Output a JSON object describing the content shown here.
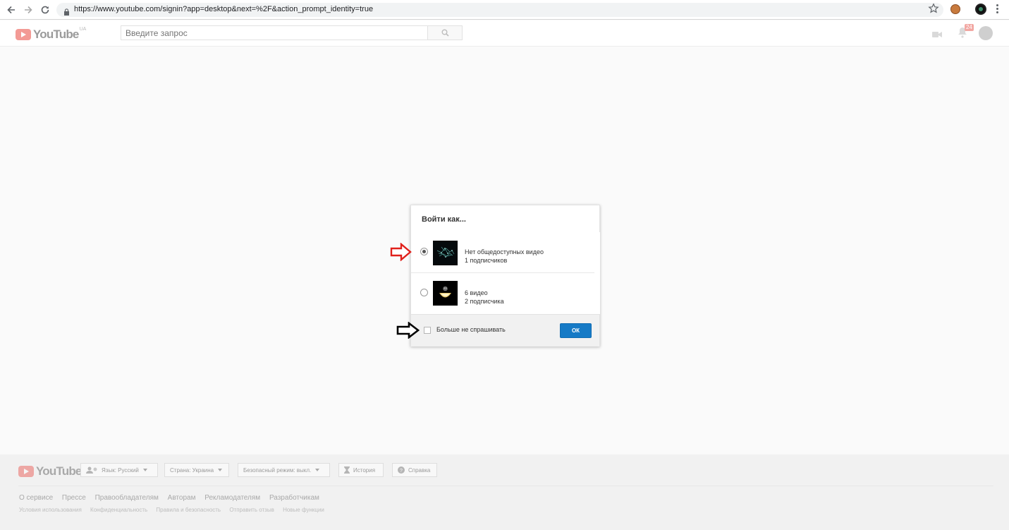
{
  "browser": {
    "url": "https://www.youtube.com/signin?app=desktop&next=%2F&action_prompt_identity=true"
  },
  "masthead": {
    "logo_text": "YouTube",
    "logo_region": "UA",
    "search_placeholder": "Введите запрос",
    "notification_count": "24"
  },
  "dialog": {
    "title": "Войти как...",
    "accounts": [
      {
        "line1": "Нет общедоступных видео",
        "line2": "1   подписчиков",
        "selected": true
      },
      {
        "line1": "6 видео",
        "line2": "2 подписчика",
        "selected": false
      }
    ],
    "dont_ask_label": "Больше не спрашивать",
    "ok_label": "ОК"
  },
  "footer": {
    "logo_text": "YouTube",
    "language": "Язык: Русский",
    "country": "Страна: Украина",
    "safe_mode": "Безопасный режим: выкл.",
    "history": "История",
    "help": "Справка",
    "links": [
      "О сервисе",
      "Прессе",
      "Правообладателям",
      "Авторам",
      "Рекламодателям",
      "Разработчикам"
    ],
    "sublinks": [
      "Условия использования",
      "Конфиденциальность",
      "Правила и безопасность",
      "Отправить отзыв",
      "Новые функции"
    ]
  },
  "colors": {
    "youtube_red": "#e62117",
    "ok_blue": "#167ac6",
    "annotation_red": "#e0201b",
    "annotation_black": "#000000"
  }
}
